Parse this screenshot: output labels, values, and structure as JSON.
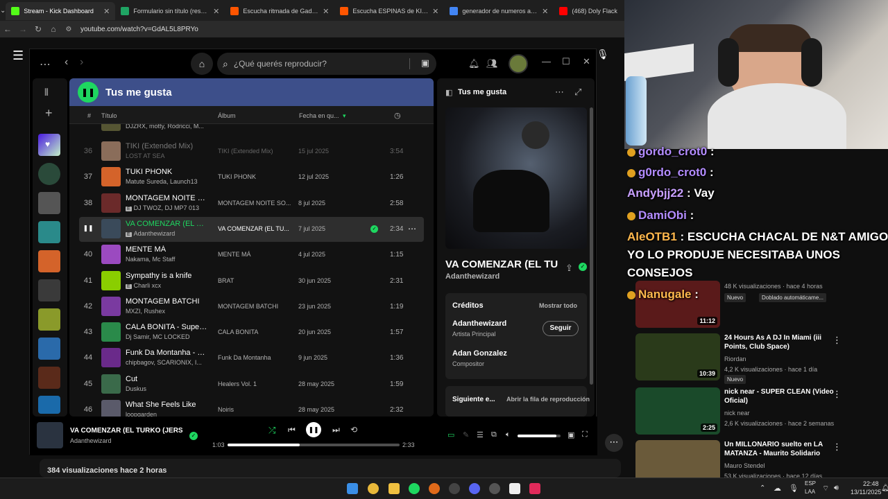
{
  "browser": {
    "tabs": [
      {
        "title": "Stream - Kick Dashboard",
        "color": "#53fc18"
      },
      {
        "title": "Formulario sin título (respuesta",
        "color": "#1fa463"
      },
      {
        "title": "Escucha ritmada de Gaddu | Di",
        "color": "#ff5500"
      },
      {
        "title": "Escucha ESPINAS de KID Kyoki",
        "color": "#ff5500"
      },
      {
        "title": "generador de numeros aleatori",
        "color": "#4285f4"
      },
      {
        "title": "(468) Doly Flack",
        "color": "#ff0000"
      }
    ],
    "url": "youtube.com/watch?v=GdAL5L8PRYo"
  },
  "spotify": {
    "search_placeholder": "¿Qué querés reproducir?",
    "playlist_title": "Tus me gusta",
    "columns": {
      "num": "#",
      "title": "Título",
      "album": "Álbum",
      "date": "Fecha en qu..."
    },
    "partial_row_artist": "DJZRX, motty, Rodricci, M...",
    "rows": [
      {
        "num": "36",
        "name": "TIKI (Extended Mix)",
        "artist": "LOST AT SEA",
        "album": "TIKI (Extended Mix)",
        "date": "15 jul 2025",
        "dur": "3:54",
        "explicit": false,
        "dim": true,
        "color": "#8a6d5a"
      },
      {
        "num": "37",
        "name": "TUKI PHONK",
        "artist": "Matute Sureda, Launch13",
        "album": "TUKI PHONK",
        "date": "12 jul 2025",
        "dur": "1:26",
        "explicit": false,
        "color": "#d4632a"
      },
      {
        "num": "38",
        "name": "MONTAGEM NOITE S...",
        "artist": "DJ TWOZ, DJ MP7 013",
        "album": "MONTAGEM NOITE SO...",
        "date": "8 jul 2025",
        "dur": "2:58",
        "explicit": true,
        "color": "#6b2a2a"
      },
      {
        "num": "",
        "name": "VA COMENZAR (EL TU...",
        "artist": "Adanthewizard",
        "album": "VA COMENZAR (EL TU...",
        "date": "7 jul 2025",
        "dur": "2:34",
        "explicit": true,
        "playing": true,
        "color": "#3a4a5a"
      },
      {
        "num": "40",
        "name": "MENTE MÁ",
        "artist": "Nakama, Mc Staff",
        "album": "MENTE MÁ",
        "date": "4 jul 2025",
        "dur": "1:15",
        "explicit": false,
        "color": "#9b4ac0"
      },
      {
        "num": "41",
        "name": "Sympathy is a knife",
        "artist": "Charli xcx",
        "album": "BRAT",
        "date": "30 jun 2025",
        "dur": "2:31",
        "explicit": true,
        "color": "#8ace00"
      },
      {
        "num": "42",
        "name": "MONTAGEM BATCHI",
        "artist": "MXZI, Rushex",
        "album": "MONTAGEM BATCHI",
        "date": "23 jun 2025",
        "dur": "1:19",
        "explicit": false,
        "color": "#7a3aa0"
      },
      {
        "num": "43",
        "name": "CALA BONITA - Super ...",
        "artist": "Dj Samir, MC LOCKED",
        "album": "CALA BONITA",
        "date": "20 jun 2025",
        "dur": "1:57",
        "explicit": false,
        "color": "#2a8a4a"
      },
      {
        "num": "44",
        "name": "Funk Da Montanha - Sl...",
        "artist": "chipbagov, SCARIONIX, I...",
        "album": "Funk Da Montanha",
        "date": "9 jun 2025",
        "dur": "1:36",
        "explicit": false,
        "color": "#6a2a8a"
      },
      {
        "num": "45",
        "name": "Cut",
        "artist": "Duskus",
        "album": "Healers Vol. 1",
        "date": "28 may 2025",
        "dur": "1:59",
        "explicit": false,
        "color": "#3a6a4a"
      },
      {
        "num": "46",
        "name": "What She Feels Like",
        "artist": "loopgarden",
        "album": "Noiris",
        "date": "28 may 2025",
        "dur": "2:32",
        "explicit": false,
        "color": "#5a5a6a"
      }
    ],
    "right_panel": {
      "title": "Tus me gusta",
      "track_title": "VA COMENZAR (EL TU",
      "track_artist": "Adanthewizard",
      "credits_label": "Créditos",
      "show_all": "Mostrar todo",
      "credits": [
        {
          "name": "Adanthewizard",
          "role": "Artista Principal"
        },
        {
          "name": "Adan Gonzalez",
          "role": "Compositor"
        }
      ],
      "follow_label": "Seguir",
      "next_label": "Siguiente e...",
      "open_queue": "Abrir la fila de reproducción"
    },
    "now_playing": {
      "title": "VA COMENZAR (EL TURKO (JERSEY CL",
      "artist": "Adanthewizard",
      "elapsed": "1:03",
      "total": "2:33",
      "progress": 0.42,
      "volume": 0.9
    }
  },
  "youtube": {
    "views": "384 visualizaciones  hace 2 horas"
  },
  "chat": [
    {
      "user": "gordo_crot0",
      "msg": ":",
      "color": "#b38cff"
    },
    {
      "user": "g0rdo_crot0",
      "msg": ":",
      "color": "#b38cff"
    },
    {
      "user": "Andybjj22",
      "msg": ": Vay",
      "color": "#c8a0ff"
    },
    {
      "user": "DamiObi",
      "msg": ":",
      "color": "#b38cff"
    },
    {
      "user": "AleOTB1",
      "msg": ": ESCUCHA CHACAL DE N&T AMIGO",
      "color": "#ffb84d"
    },
    {
      "user": "",
      "msg": "YO LO PRODUJE NECESITABA UNOS",
      "color": "#fff"
    },
    {
      "user": "",
      "msg": "CONSEJOS",
      "color": "#fff"
    },
    {
      "user": "Nanugale",
      "msg": ":",
      "color": "#ffb84d"
    }
  ],
  "recommendations": [
    {
      "title": "",
      "channel": "",
      "meta": "48 K visualizaciones · hace 4 horas",
      "badge": "Nuevo",
      "badge2": "Doblado automáticame...",
      "dur": "11:12",
      "color": "#5a1a1a"
    },
    {
      "title": "24 Hours As A DJ In Miami (iii Points, Club Space)",
      "channel": "Riordan",
      "meta": "4,2 K visualizaciones · hace 1 día",
      "badge": "Nuevo",
      "dur": "10:39",
      "color": "#2a3a1a"
    },
    {
      "title": "nick near - SUPER CLEAN (Video Oficial)",
      "channel": "nick near",
      "meta": "2,6 K visualizaciones · hace 2 semanas",
      "dur": "2:25",
      "color": "#1a4a2a"
    },
    {
      "title": "Un MILLONARIO suelto en LA MATANZA - Maurito Solidario",
      "channel": "Mauro Stendel",
      "meta": "53 K visualizaciones · hace 12 días",
      "color": "#6a5a3a"
    }
  ],
  "taskbar": {
    "lang": "ESP",
    "lang2": "LAA",
    "time": "22:48",
    "date": "13/11/2025"
  }
}
